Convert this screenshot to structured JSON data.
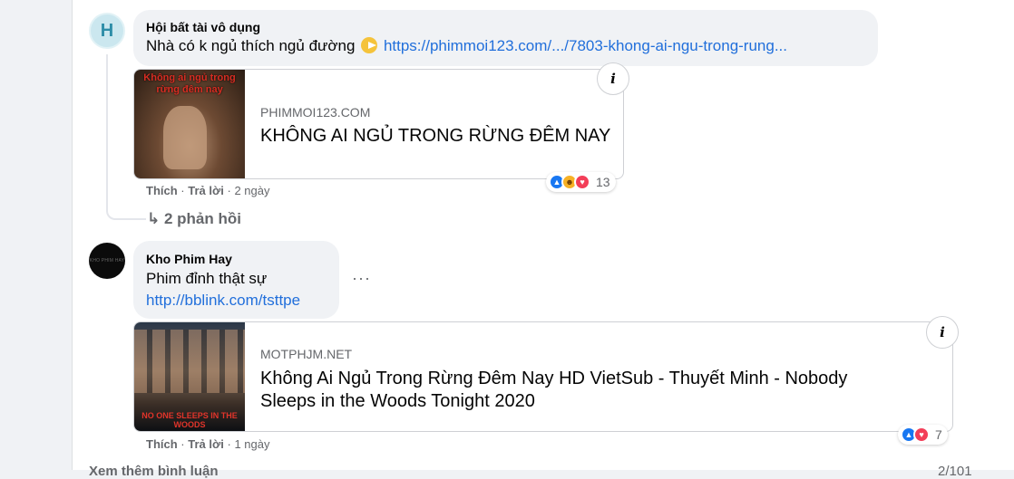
{
  "comment1": {
    "avatar_letter": "H",
    "author": "Hội bất tài vô dụng",
    "text": "Nhà có k ngủ thích ngủ đường",
    "link": "https://phimmoi123.com/.../7803-khong-ai-ngu-trong-rung...",
    "card": {
      "thumb_title": "Không ai ngủ trong rừng đêm nay",
      "domain": "PHIMMOI123.COM",
      "title": "KHÔNG AI NGỦ TRONG RỪNG ĐÊM NAY"
    },
    "actions": {
      "like": "Thích",
      "reply": "Trả lời",
      "time": "2 ngày",
      "sep": "·"
    },
    "reactions": {
      "count": "13",
      "icons": [
        "like-icon",
        "haha-icon",
        "love-icon"
      ]
    },
    "replies_label": "2 phản hồi"
  },
  "comment2": {
    "author": "Kho Phim Hay",
    "avatar_text": "KHO PHIM HAY",
    "text": "Phim đỉnh thật sự",
    "link": "http://bblink.com/tsttpe",
    "more": "···",
    "card": {
      "thumb_title": "NO ONE SLEEPS IN THE WOODS",
      "domain": "MOTPHJM.NET",
      "title_line1": "Không Ai Ngủ Trong Rừng Đêm Nay HD VietSub - Thuyết Minh - Nobody",
      "title_line2": "Sleeps in the Woods Tonight 2020"
    },
    "actions": {
      "like": "Thích",
      "reply": "Trả lời",
      "time": "1 ngày",
      "sep": "·"
    },
    "reactions": {
      "count": "7",
      "icons": [
        "like-icon",
        "love-icon"
      ]
    }
  },
  "footer": {
    "more_comments": "Xem thêm bình luận",
    "counter": "2/101"
  },
  "colors": {
    "link": "#216fdb",
    "bubble": "#f0f2f5",
    "secondary_text": "#65676b"
  }
}
